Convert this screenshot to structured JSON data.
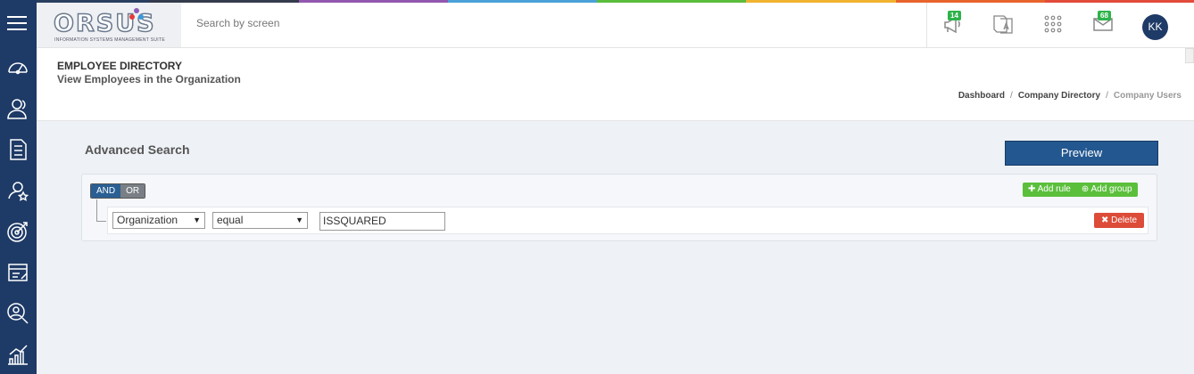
{
  "colors": {
    "sidebar": "#1e3a66",
    "accent": "#23578f",
    "success": "#5bbf3c",
    "danger": "#dd4b39",
    "badge": "#2db34a",
    "rainbow": [
      "#2a3f5f",
      "#333b4c",
      "#9257b0",
      "#4aa2d9",
      "#5bbd3c",
      "#f0b330",
      "#e8642c",
      "#e34b3b"
    ]
  },
  "logo": {
    "text": "ORSUS",
    "subtitle": "INFORMATION SYSTEMS MANAGEMENT SUITE"
  },
  "search": {
    "placeholder": "Search by screen"
  },
  "topbar": {
    "announcements_badge": "14",
    "messages_badge": "68",
    "avatar_initials": "KK"
  },
  "sidebar": {
    "items": [
      {
        "icon": "dashboard-gauge-icon"
      },
      {
        "icon": "users-icon"
      },
      {
        "icon": "checklist-icon"
      },
      {
        "icon": "user-star-icon"
      },
      {
        "icon": "target-icon"
      },
      {
        "icon": "edit-report-icon"
      },
      {
        "icon": "user-search-icon"
      },
      {
        "icon": "bar-chart-icon"
      }
    ]
  },
  "page": {
    "title": "EMPLOYEE DIRECTORY",
    "subtitle": "View Employees in the Organization"
  },
  "breadcrumb": {
    "items": [
      "Dashboard",
      "Company Directory",
      "Company Users"
    ],
    "separator": "/"
  },
  "advanced_search": {
    "title": "Advanced Search",
    "preview_label": "Preview",
    "and_label": "AND",
    "or_label": "OR",
    "add_rule_label": "Add rule",
    "add_group_label": "Add group",
    "rule": {
      "field": "Organization",
      "operator": "equal",
      "value": "ISSQUARED",
      "delete_label": "Delete"
    }
  }
}
